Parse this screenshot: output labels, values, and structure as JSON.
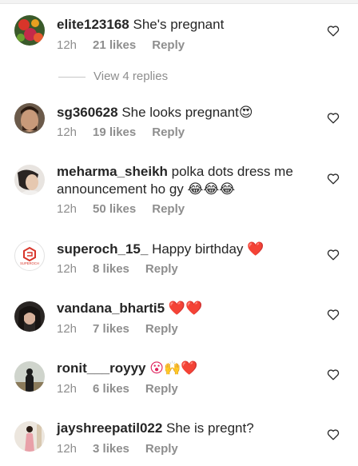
{
  "comments": [
    {
      "username": "elite123168",
      "text": "She's pregnant",
      "emoji": "",
      "time": "12h",
      "likes": "21 likes",
      "reply": "Reply"
    },
    {
      "username": "sg360628",
      "text": "She looks pregnant",
      "emoji": "😍",
      "time": "12h",
      "likes": "19 likes",
      "reply": "Reply"
    },
    {
      "username": "meharma_sheikh",
      "text": "polka dots dress me announcement ho gy",
      "emoji": "😂😂😂",
      "time": "12h",
      "likes": "50 likes",
      "reply": "Reply"
    },
    {
      "username": "superoch_15_",
      "text": "Happy birthday",
      "emoji": "❤️",
      "time": "12h",
      "likes": "8 likes",
      "reply": "Reply"
    },
    {
      "username": "vandana_bharti5",
      "text": "",
      "emoji": "❤️❤️",
      "time": "12h",
      "likes": "7 likes",
      "reply": "Reply"
    },
    {
      "username": "ronit___royyy",
      "text": "",
      "emoji": "😮🙌❤️",
      "time": "12h",
      "likes": "6 likes",
      "reply": "Reply"
    },
    {
      "username": "jayshreepatil022",
      "text": "She is pregnt?",
      "emoji": "",
      "time": "12h",
      "likes": "3 likes",
      "reply": "Reply"
    }
  ],
  "view_replies": "View 4 replies",
  "avatar_logo_text": "SUPEROCH",
  "colors": {
    "text": "#262626",
    "secondary": "#8e8e8e",
    "heart": "#e0245e"
  }
}
